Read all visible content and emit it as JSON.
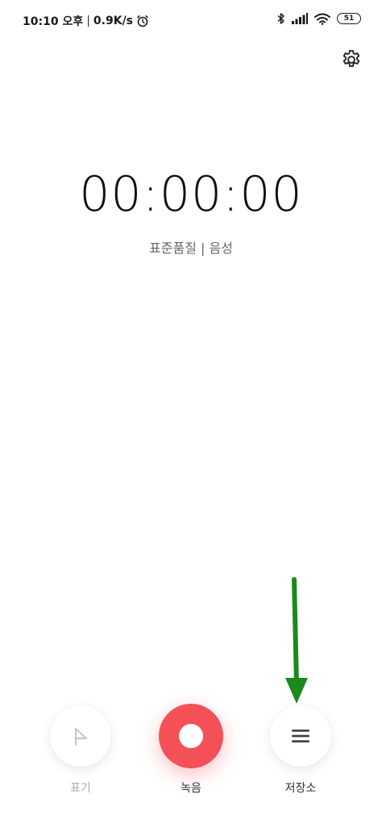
{
  "status_bar": {
    "time": "10:10 오후",
    "separator": "|",
    "net_speed": "0.9K/s",
    "alarm_icon": "alarm-clock-icon",
    "bluetooth_icon": "bluetooth-icon",
    "signal_icon": "signal-icon",
    "wifi_icon": "wifi-icon",
    "battery_level": "51"
  },
  "header": {
    "settings_icon": "gear-icon"
  },
  "timer": {
    "display": "00:00:00",
    "quality_label": "표준품질 | 음성"
  },
  "annotation": {
    "arrow_color": "#1a8a1a"
  },
  "controls": {
    "mark_label": "표기",
    "record_label": "녹음",
    "storage_label": "저장소",
    "record_color": "#f45058"
  }
}
